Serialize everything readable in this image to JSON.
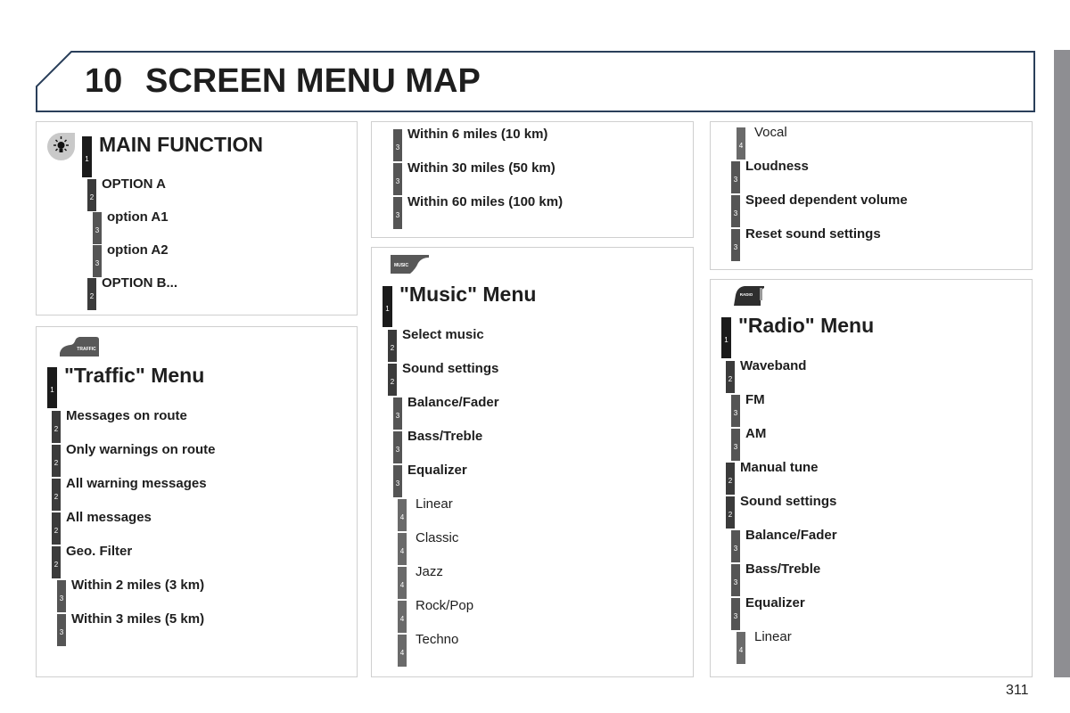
{
  "header": {
    "chapter_number": "10",
    "chapter_title": "SCREEN MENU MAP"
  },
  "page_number": "311",
  "colors": {
    "header_border": "#2a3f5a",
    "level1": "#1b1b1b",
    "level2": "#3b3b3b",
    "level3": "#555555",
    "level4": "#6a6a6a",
    "side_tab": "#8e8e92"
  },
  "panels": {
    "main_function": {
      "icon": "lightbulb-icon",
      "items": [
        {
          "level": "1",
          "label": "MAIN FUNCTION"
        },
        {
          "level": "2",
          "label": "OPTION A"
        },
        {
          "level": "3",
          "label": "option A1"
        },
        {
          "level": "3",
          "label": "option A2"
        },
        {
          "level": "2",
          "label": "OPTION B..."
        }
      ]
    },
    "traffic": {
      "badge": "TRAFFIC",
      "items": [
        {
          "level": "1",
          "label": "\"Traffic\" Menu"
        },
        {
          "level": "2",
          "label": "Messages on route"
        },
        {
          "level": "2",
          "label": "Only warnings on route"
        },
        {
          "level": "2",
          "label": "All warning messages"
        },
        {
          "level": "2",
          "label": "All messages"
        },
        {
          "level": "2",
          "label": "Geo. Filter"
        },
        {
          "level": "3",
          "label": "Within 2 miles (3 km)"
        },
        {
          "level": "3",
          "label": "Within 3 miles (5 km)"
        }
      ]
    },
    "traffic_cont": {
      "items": [
        {
          "level": "3",
          "label": "Within 6 miles (10 km)"
        },
        {
          "level": "3",
          "label": "Within 30 miles (50 km)"
        },
        {
          "level": "3",
          "label": "Within 60 miles (100 km)"
        }
      ]
    },
    "music": {
      "badge": "MUSIC",
      "items": [
        {
          "level": "1",
          "label": "\"Music\" Menu"
        },
        {
          "level": "2",
          "label": "Select music"
        },
        {
          "level": "2",
          "label": "Sound settings"
        },
        {
          "level": "3",
          "label": "Balance/Fader"
        },
        {
          "level": "3",
          "label": "Bass/Treble"
        },
        {
          "level": "3",
          "label": "Equalizer"
        },
        {
          "level": "4",
          "label": "Linear"
        },
        {
          "level": "4",
          "label": "Classic"
        },
        {
          "level": "4",
          "label": "Jazz"
        },
        {
          "level": "4",
          "label": "Rock/Pop"
        },
        {
          "level": "4",
          "label": "Techno"
        }
      ]
    },
    "music_cont": {
      "items": [
        {
          "level": "4",
          "label": "Vocal"
        },
        {
          "level": "3",
          "label": "Loudness"
        },
        {
          "level": "3",
          "label": "Speed dependent volume"
        },
        {
          "level": "3",
          "label": "Reset sound settings"
        }
      ]
    },
    "radio": {
      "badge": "RADIO",
      "items": [
        {
          "level": "1",
          "label": "\"Radio\" Menu"
        },
        {
          "level": "2",
          "label": "Waveband"
        },
        {
          "level": "3",
          "label": "FM"
        },
        {
          "level": "3",
          "label": "AM"
        },
        {
          "level": "2",
          "label": "Manual tune"
        },
        {
          "level": "2",
          "label": "Sound settings"
        },
        {
          "level": "3",
          "label": "Balance/Fader"
        },
        {
          "level": "3",
          "label": "Bass/Treble"
        },
        {
          "level": "3",
          "label": "Equalizer"
        },
        {
          "level": "4",
          "label": "Linear"
        }
      ]
    }
  }
}
